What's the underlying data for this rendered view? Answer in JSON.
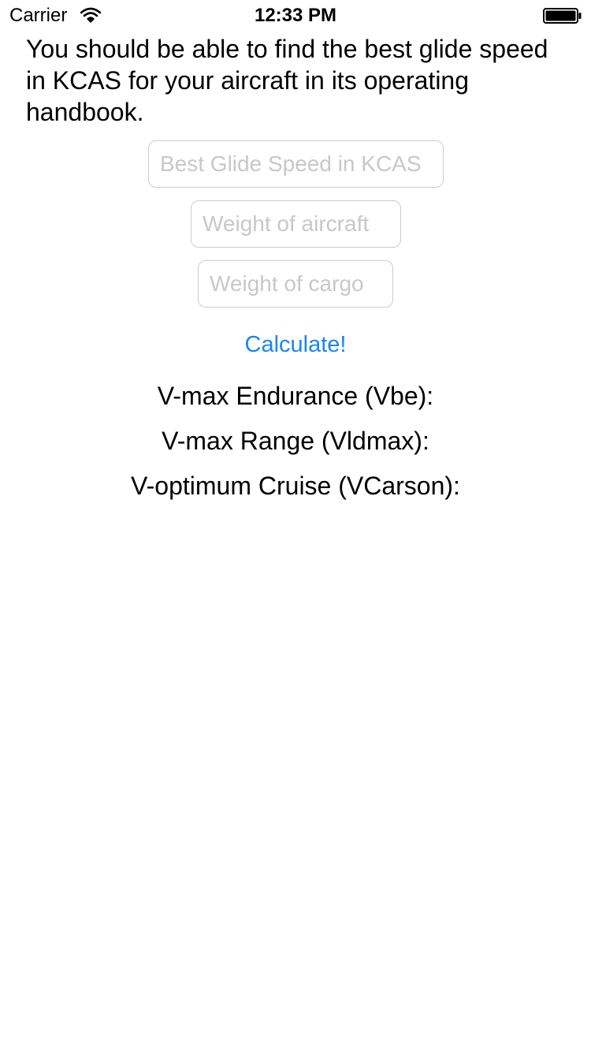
{
  "status_bar": {
    "carrier": "Carrier",
    "time": "12:33 PM",
    "icons": [
      "wifi-icon",
      "battery-icon"
    ]
  },
  "intro_text": "You should be able to find the best glide speed in KCAS for your aircraft in its operating handbook.",
  "inputs": {
    "glide_speed": {
      "placeholder": "Best Glide Speed in KCAS",
      "value": ""
    },
    "aircraft_weight": {
      "placeholder": "Weight of aircraft",
      "value": ""
    },
    "cargo_weight": {
      "placeholder": "Weight of cargo",
      "value": ""
    }
  },
  "calculate_label": "Calculate!",
  "results": {
    "vbe": "V-max Endurance (Vbe):",
    "vldmax": "V-max Range (Vldmax):",
    "vcarson": "V-optimum Cruise (VCarson):"
  },
  "colors": {
    "accent": "#1a84f4",
    "text": "#000000",
    "field_border": "#cccccc",
    "placeholder": "#c7c7cd",
    "background": "#ffffff"
  }
}
